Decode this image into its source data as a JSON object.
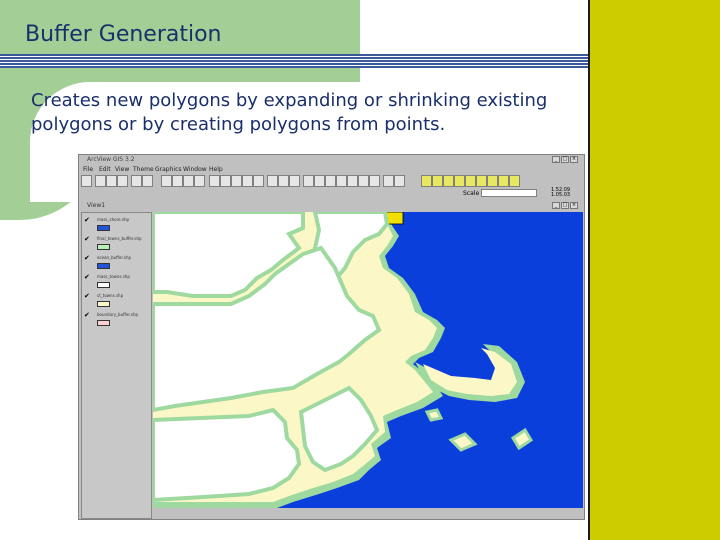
{
  "slide": {
    "title": "Buffer Generation",
    "body": "Creates new polygons by expanding or shrinking existing polygons or by creating polygons from points."
  },
  "colors": {
    "green": "#a3cf97",
    "yellow": "#cccc00",
    "navy": "#1a2f6a",
    "ocean": "#0a3fdc",
    "land": "#fcf7c6",
    "buffer": "#9ed9a0"
  },
  "app": {
    "title": "ArcView GIS 3.2",
    "menus": [
      "File",
      "Edit",
      "View",
      "Theme",
      "Graphics",
      "Window",
      "Help"
    ],
    "scale_label": "Scale 1:",
    "coords": [
      "1.52.09",
      "1.05.03"
    ],
    "view_title": "View1",
    "legend": [
      {
        "name": "mass_shore.shp",
        "swatch": "#1f55d6"
      },
      {
        "name": "final_towns_buffer.shp",
        "swatch": "#b8f0b8"
      },
      {
        "name": "ocean_buffer.shp",
        "swatch": "#1f55d6"
      },
      {
        "name": "mass_towns.shp",
        "swatch": "#ffffff"
      },
      {
        "name": "ct_towns.shp",
        "swatch": "#fcf7c6"
      },
      {
        "name": "boundary_buffer.shp",
        "swatch": "#ffd0d0"
      }
    ]
  }
}
